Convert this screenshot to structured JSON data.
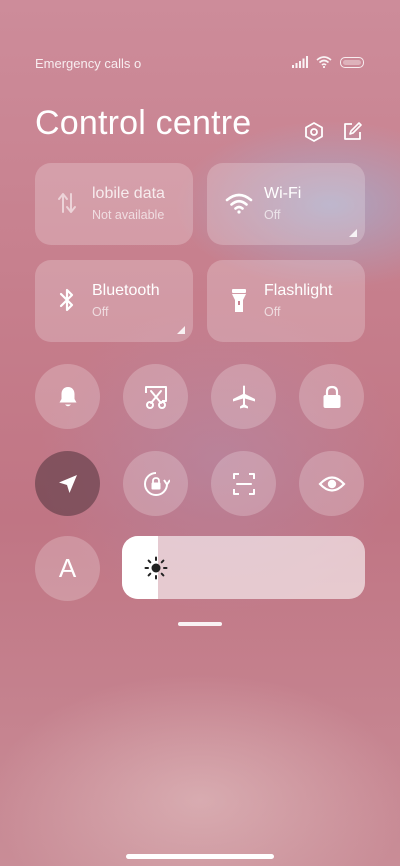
{
  "status": {
    "carrier_text": "Emergency calls o",
    "icons": [
      "signal-icon",
      "wifi-icon",
      "battery-icon"
    ]
  },
  "header": {
    "title": "Control centre",
    "actions": [
      "settings-icon",
      "edit-icon"
    ]
  },
  "tiles": [
    {
      "name": "mobile-data",
      "label": "Mobile data",
      "label_visible": "lobile data",
      "state": "Not available",
      "icon": "mobile-data-icon"
    },
    {
      "name": "wifi",
      "label": "Wi-Fi",
      "state": "Off",
      "icon": "wifi-icon"
    },
    {
      "name": "bluetooth",
      "label": "Bluetooth",
      "state": "Off",
      "icon": "bluetooth-icon"
    },
    {
      "name": "flashlight",
      "label": "Flashlight",
      "state": "Off",
      "icon": "flashlight-icon"
    }
  ],
  "toggles_row1": [
    "bell-icon",
    "screenshot-icon",
    "airplane-icon",
    "lock-icon"
  ],
  "toggles_row2": [
    "location-icon",
    "rotation-lock-icon",
    "scanner-icon",
    "eye-icon"
  ],
  "auto_brightness_label": "A",
  "brightness": {
    "level": 0.15,
    "icon": "brightness-icon"
  },
  "colors": {
    "active_toggle": "#6e4650",
    "tile_bg": "rgba(255,255,255,0.22)"
  }
}
